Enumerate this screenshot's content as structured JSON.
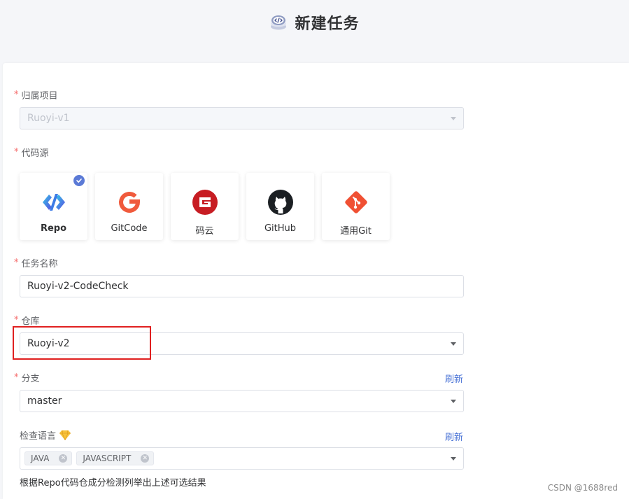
{
  "header": {
    "title": "新建任务"
  },
  "form": {
    "project": {
      "label": "归属项目",
      "value": "Ruoyi-v1"
    },
    "source": {
      "label": "代码源",
      "options": [
        {
          "label": "Repo",
          "icon": "repo-icon",
          "selected": true
        },
        {
          "label": "GitCode",
          "icon": "gitcode-icon"
        },
        {
          "label": "码云",
          "icon": "gitee-icon"
        },
        {
          "label": "GitHub",
          "icon": "github-icon"
        },
        {
          "label": "通用Git",
          "icon": "git-icon"
        }
      ]
    },
    "task_name": {
      "label": "任务名称",
      "value": "Ruoyi-v2-CodeCheck"
    },
    "repository": {
      "label": "仓库",
      "value": "Ruoyi-v2"
    },
    "branch": {
      "label": "分支",
      "value": "master",
      "refresh": "刷新"
    },
    "language": {
      "label": "检查语言",
      "refresh": "刷新",
      "tags": [
        "JAVA",
        "JAVASCRIPT"
      ],
      "help": "根据Repo代码仓成分检测列举出上述可选结果"
    }
  },
  "watermark": "CSDN @1688red",
  "colors": {
    "accent": "#4a73d6",
    "required": "#f56c6c",
    "highlight": "#e02020"
  }
}
